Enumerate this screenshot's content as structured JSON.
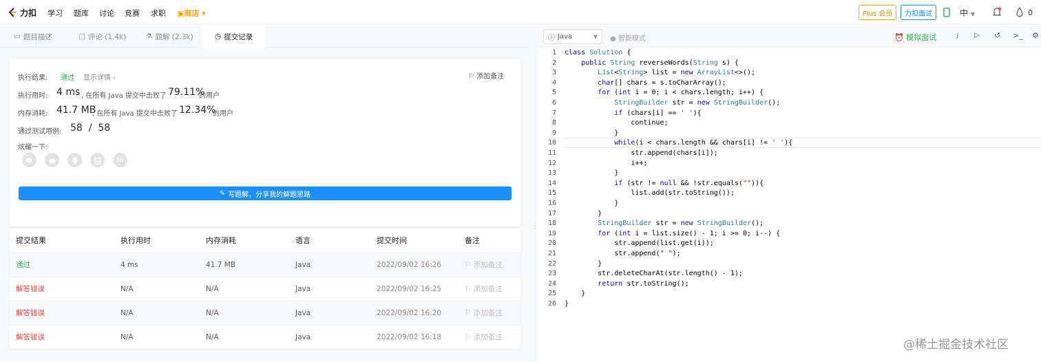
{
  "nav": {
    "logo": "力扣",
    "items": [
      "学习",
      "题库",
      "讨论",
      "竞赛",
      "求职"
    ],
    "shop": "商店",
    "plus": "Plus 会员",
    "interview": "力扣面试",
    "lang": "中",
    "points": "0"
  },
  "tabs": [
    {
      "label": "题目描述"
    },
    {
      "label": "评论 (1.4k)"
    },
    {
      "label": "题解 (2.3k)"
    },
    {
      "label": "提交记录"
    }
  ],
  "result": {
    "label_result": "执行结果:",
    "status": "通过",
    "details": "显示详情 ›",
    "add_note": "添加备注",
    "label_time": "执行用时:",
    "time": "4 ms",
    "time_mid": ", 在所有 Java 提交中击败了",
    "time_pct": "79.11%",
    "time_end": "的用户",
    "label_mem": "内存消耗:",
    "mem": "41.7 MB",
    "mem_mid": ", 在所有 Java 提交中击败了",
    "mem_pct": "12.34%",
    "mem_end": "的用户",
    "label_tests": "通过测试用例:",
    "tests": "58  /  58",
    "label_share": "炫耀一下:",
    "share_icons": [
      "wechat-icon",
      "weibo-icon",
      "qq-icon",
      "douban-icon",
      "linkedin-icon"
    ],
    "write_btn": "写题解，分享我的解题思路"
  },
  "table": {
    "headers": [
      "提交结果",
      "执行用时",
      "内存消耗",
      "语言",
      "提交时间",
      "备注"
    ],
    "rows": [
      {
        "status": "通过",
        "time": "4 ms",
        "mem": "41.7 MB",
        "lang": "Java",
        "date": "2022/09/02 16:26",
        "note": "添加备注",
        "ok": true
      },
      {
        "status": "解答错误",
        "time": "N/A",
        "mem": "N/A",
        "lang": "Java",
        "date": "2022/09/02 16:25",
        "note": "添加备注",
        "ok": false
      },
      {
        "status": "解答错误",
        "time": "N/A",
        "mem": "N/A",
        "lang": "Java",
        "date": "2022/09/02 16:20",
        "note": "添加备注",
        "ok": false
      },
      {
        "status": "解答错误",
        "time": "N/A",
        "mem": "N/A",
        "lang": "Java",
        "date": "2022/09/02 16:18",
        "note": "添加备注",
        "ok": false
      }
    ]
  },
  "editor": {
    "language": "Java",
    "smart_mode": "智能模式",
    "mock_interview": "模拟面试",
    "lines": [
      "class Solution {",
      "    public String reverseWords(String s) {",
      "        List<String> list = new ArrayList<>();",
      "        char[] chars = s.toCharArray();",
      "        for (int i = 0; i < chars.length; i++) {",
      "            StringBuilder str = new StringBuilder();",
      "            if (chars[i] == ' '){",
      "                continue;",
      "            }",
      "            while(i < chars.length && chars[i] != ' '){",
      "                str.append(chars[i]);",
      "                i++;",
      "            }",
      "            if (str != null && !str.equals(\"\")){",
      "                list.add(str.toString());",
      "            }",
      "        }",
      "        StringBuilder str = new StringBuilder();",
      "        for (int i = list.size() - 1; i >= 0; i--) {",
      "            str.append(list.get(i));",
      "            str.append(\" \");",
      "        }",
      "        str.deleteCharAt(str.length() - 1);",
      "        return str.toString();",
      "    }",
      "}"
    ]
  },
  "watermark": "@稀土掘金技术社区",
  "colors": {
    "accent": "#1a90ff",
    "success": "#2db55d",
    "error": "#ef4743",
    "brand": "#ffa116"
  }
}
